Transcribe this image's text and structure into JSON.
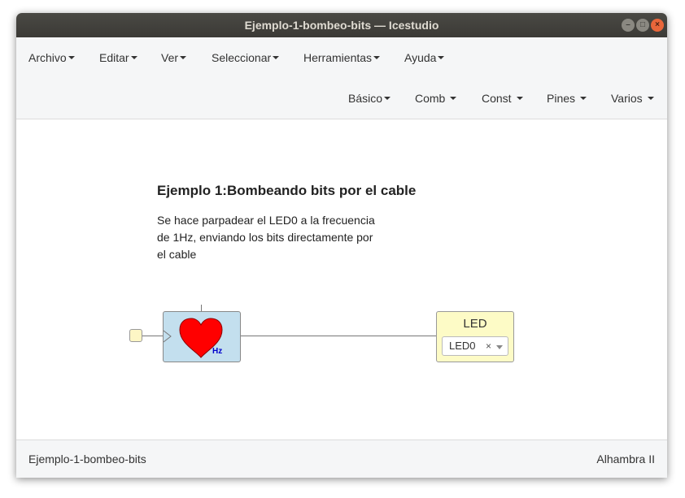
{
  "window": {
    "title": "Ejemplo-1-bombeo-bits — Icestudio"
  },
  "menubar": {
    "items": [
      "Archivo",
      "Editar",
      "Ver",
      "Seleccionar",
      "Herramientas",
      "Ayuda"
    ]
  },
  "toolbar": {
    "items": [
      "Básico",
      "Comb",
      "Const",
      "Pines",
      "Varios"
    ]
  },
  "canvas": {
    "info_title": "Ejemplo 1:Bombeando bits por el cable",
    "info_text": "Se hace parpadear el LED0 a la frecuencia de 1Hz, enviando los bits directamente por el cable",
    "clock_block": {
      "icon": "heart-icon",
      "unit_label": "Hz",
      "color": "#c3dfee"
    },
    "led_block": {
      "title": "LED",
      "selected_pin": "LED0",
      "clear_symbol": "×",
      "color": "#fdfbc6"
    }
  },
  "statusbar": {
    "project_name": "Ejemplo-1-bombeo-bits",
    "board": "Alhambra II"
  }
}
